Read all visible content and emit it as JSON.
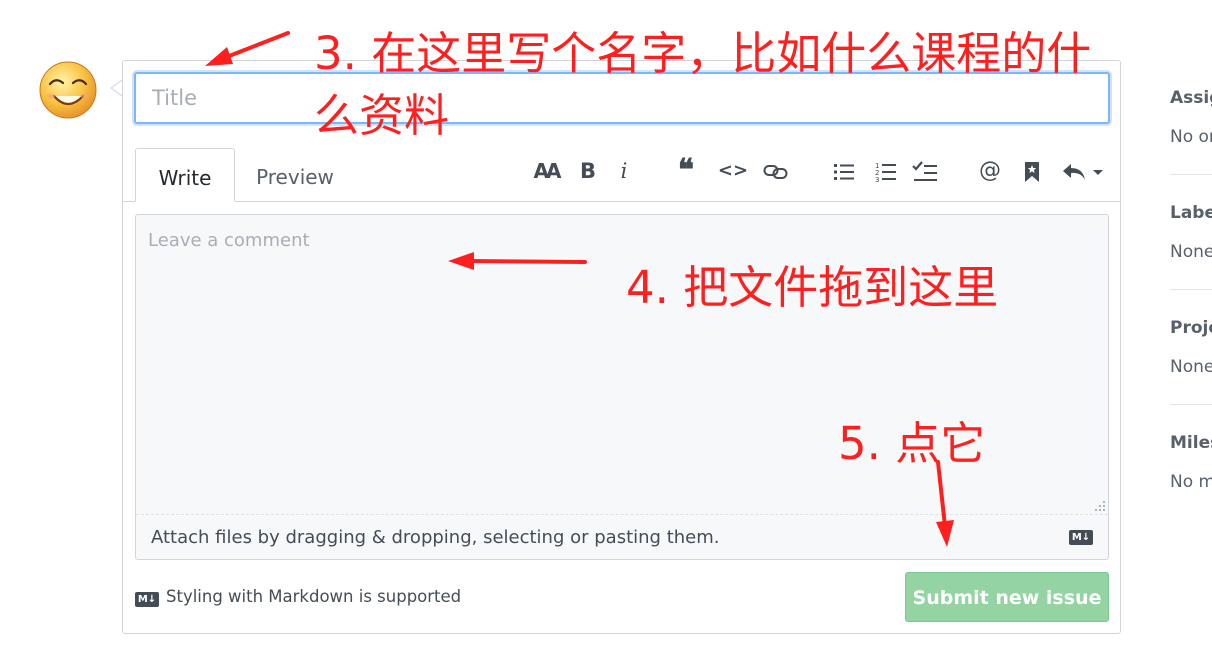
{
  "issue_form": {
    "title_placeholder": "Title",
    "tabs": [
      {
        "label": "Write",
        "active": true
      },
      {
        "label": "Preview",
        "active": false
      }
    ],
    "toolbar": {
      "header": "AA",
      "bold": "B",
      "italic": "i",
      "quote": "❝",
      "code": "<>",
      "link": "link-icon",
      "unordered_list": "list-unordered-icon",
      "ordered_list": "list-ordered-icon",
      "task_list": "tasklist-icon",
      "mention": "@",
      "reference": "bookmark-icon",
      "reply": "reply-icon"
    },
    "comment_placeholder": "Leave a comment",
    "attach_text": "Attach files by dragging & dropping, selecting or pasting them.",
    "markdown_badge": "M↓",
    "markdown_note": "Styling with Markdown is supported",
    "submit_label": "Submit new issue"
  },
  "sidebar": {
    "sections": [
      {
        "heading": "Assig",
        "value": "No or"
      },
      {
        "heading": "Label",
        "value": "None"
      },
      {
        "heading": "Proje",
        "value": "None"
      },
      {
        "heading": "Miles",
        "value": "No m"
      }
    ]
  },
  "annotations": {
    "step3_line1": "3. 在这里写个名字，比如什么课程的什",
    "step3_line2": "么资料",
    "step4": "4. 把文件拖到这里",
    "step5": "5. 点它"
  },
  "colors": {
    "annotation_red": "#ff1f1f",
    "submit_disabled_green": "#94d3a2",
    "focus_blue": "#79b8ff",
    "border_gray": "#d1d5da"
  }
}
